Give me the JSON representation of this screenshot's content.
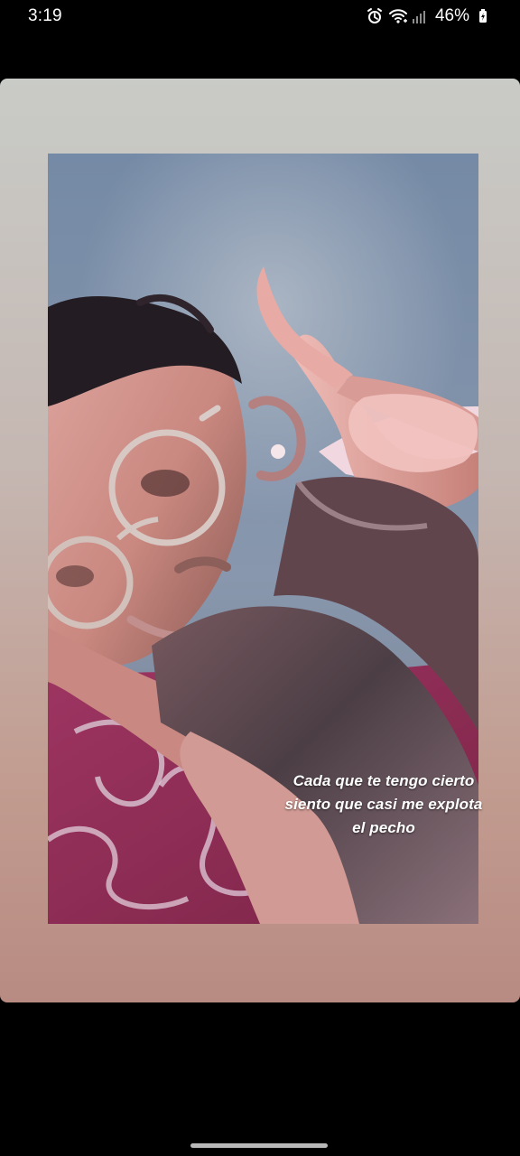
{
  "status_bar": {
    "time": "3:19",
    "battery_percent": "46%",
    "icons": [
      "alarm-icon",
      "wifi-icon",
      "signal-icon",
      "battery-charging-icon"
    ]
  },
  "story": {
    "caption_lines": [
      "Cada que te tengo cierto",
      "siento que casi me explota",
      "el pecho"
    ]
  },
  "colors": {
    "background": "#000000",
    "card_top": "#c9cbc7",
    "card_bottom": "#b88b82",
    "caption_text": "#ffffff"
  }
}
